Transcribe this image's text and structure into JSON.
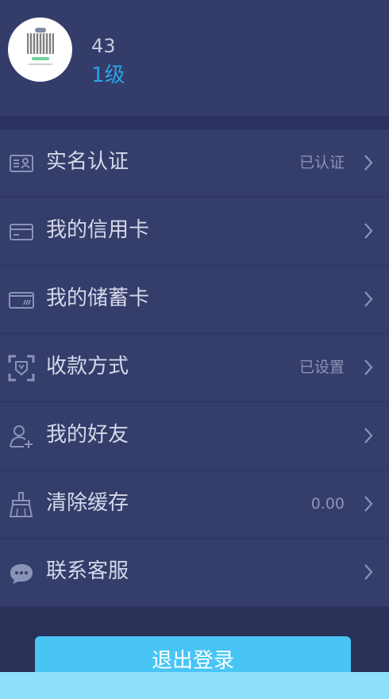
{
  "profile": {
    "uid": "43",
    "level": "1级"
  },
  "menu": [
    {
      "label": "实名认证",
      "value": "已认证",
      "icon": "id-card-icon"
    },
    {
      "label": "我的信用卡",
      "value": "",
      "icon": "credit-card-icon"
    },
    {
      "label": "我的储蓄卡",
      "value": "",
      "icon": "debit-card-icon"
    },
    {
      "label": "收款方式",
      "value": "已设置",
      "icon": "scan-payment-icon"
    },
    {
      "label": "我的好友",
      "value": "",
      "icon": "add-friend-icon"
    },
    {
      "label": "清除缓存",
      "value": "0.00",
      "icon": "broom-icon"
    },
    {
      "label": "联系客服",
      "value": "",
      "icon": "chat-bubble-icon"
    }
  ],
  "logout": {
    "label": "退出登录"
  },
  "colors": {
    "background": "#2a3159",
    "header": "#343c69",
    "item": "#353d6a",
    "accent": "#2aa3e6",
    "button": "#48c5f5",
    "icon": "#8a93b8"
  }
}
